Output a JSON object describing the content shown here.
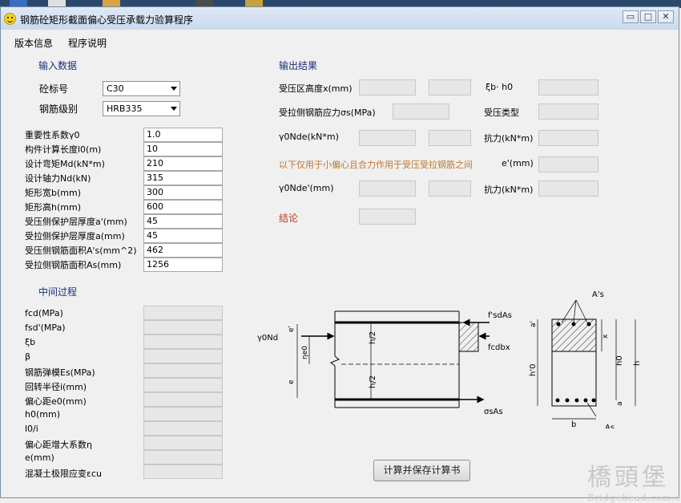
{
  "window": {
    "title": "钢筋砼矩形截面偏心受压承载力验算程序"
  },
  "menu": {
    "items": [
      "版本信息",
      "程序说明"
    ]
  },
  "input": {
    "section_title": "输入数据",
    "concrete_label": "砼标号",
    "concrete_value": "C30",
    "rebar_label": "钢筋级别",
    "rebar_value": "HRB335",
    "rows": [
      {
        "label": "重要性系数γ0",
        "value": "1.0"
      },
      {
        "label": "构件计算长度l0(m)",
        "value": "10"
      },
      {
        "label": "设计弯矩Md(kN*m)",
        "value": "210"
      },
      {
        "label": "设计轴力Nd(kN)",
        "value": "315"
      },
      {
        "label": "矩形宽b(mm)",
        "value": "300"
      },
      {
        "label": "矩形高h(mm)",
        "value": "600"
      },
      {
        "label": "受压侧保护层厚度a'(mm)",
        "value": "45"
      },
      {
        "label": "受拉侧保护层厚度a(mm)",
        "value": "45"
      },
      {
        "label": "受压侧钢筋面积A's(mm^2)",
        "value": "462"
      },
      {
        "label": "受拉侧钢筋面积As(mm)",
        "value": "1256"
      }
    ]
  },
  "middle": {
    "section_title": "中间过程",
    "rows": [
      "fcd(MPa)",
      "fsd'(MPa)",
      "ξb",
      "β",
      "钢筋弹模Es(MPa)",
      "回转半径i(mm)",
      "偏心距e0(mm)",
      "h0(mm)",
      "l0/i",
      "偏心距增大系数η",
      "e(mm)",
      "混凝土极限应变εcu"
    ]
  },
  "output": {
    "section_title": "输出结果",
    "compress_height_label": "受压区高度x(mm)",
    "xi_b_h0_label": "ξb· h0",
    "tension_stress_label": "受拉侧钢筋应力σs(MPa)",
    "compress_type_label": "受压类型",
    "gamma_ne_label": "γ0Nde(kN*m)",
    "resistance_label_1": "抗力(kN*m)",
    "note": "以下仅用于小偏心且合力作用于受压受拉钢筋之间",
    "e_prime_label": "e'(mm)",
    "gamma_ne_prime_label": "γ0Nde'(mm)",
    "resistance_label_2": "抗力(kN*m)",
    "conclusion_label": "结论"
  },
  "diagram": {
    "load_label": "γ0Nd",
    "e_label": "e",
    "e_prime_label": "e'",
    "eta_e0_label": "ηe0",
    "h_half_label": "h/2",
    "fsd_as_label": "f'sdAs",
    "fcdbx_label": "fcdbx",
    "sigma_as_label": "σsAs",
    "as_prime_label": "A's",
    "as_label": "As",
    "a_prime_label": "a'",
    "a_label": "a",
    "x_label": "x",
    "h0_label": "h0",
    "h_label": "h",
    "h0_prime_label": "h'0",
    "b_label": "b"
  },
  "actions": {
    "calc_button": "计算并保存计算书"
  },
  "watermark": {
    "text_cn": "橋頭堡",
    "text_en": "Bridgehead.com.cn"
  }
}
